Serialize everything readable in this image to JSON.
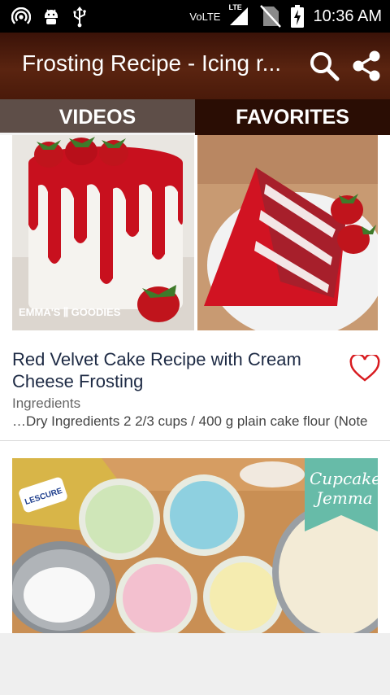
{
  "status_bar": {
    "network_label": "VoLTE",
    "lte_label": "LTE",
    "time": "10:36 AM",
    "icons": [
      "hotspot-icon",
      "android-debug-icon",
      "usb-icon",
      "signal-icon",
      "no-sim-icon",
      "battery-charging-icon"
    ]
  },
  "app_bar": {
    "title": "Frosting Recipe - Icing r...",
    "search_icon": "search-icon",
    "share_icon": "share-icon"
  },
  "tabs": [
    {
      "label": "VIDEOS"
    },
    {
      "label": "FAVORITES"
    }
  ],
  "cards": [
    {
      "image_watermark": "EMMA'S GOODIES",
      "title": "Red Velvet Cake Recipe with Cream Cheese Frosting",
      "subtitle": "Ingredients",
      "excerpt": "…Dry Ingredients 2 2/3 cups / 400 g plain cake flour (Note",
      "favorite_icon": "heart-outline-icon"
    },
    {
      "image_brand": "Cupcake Jemma",
      "packet_label": "LESCURE"
    }
  ]
}
